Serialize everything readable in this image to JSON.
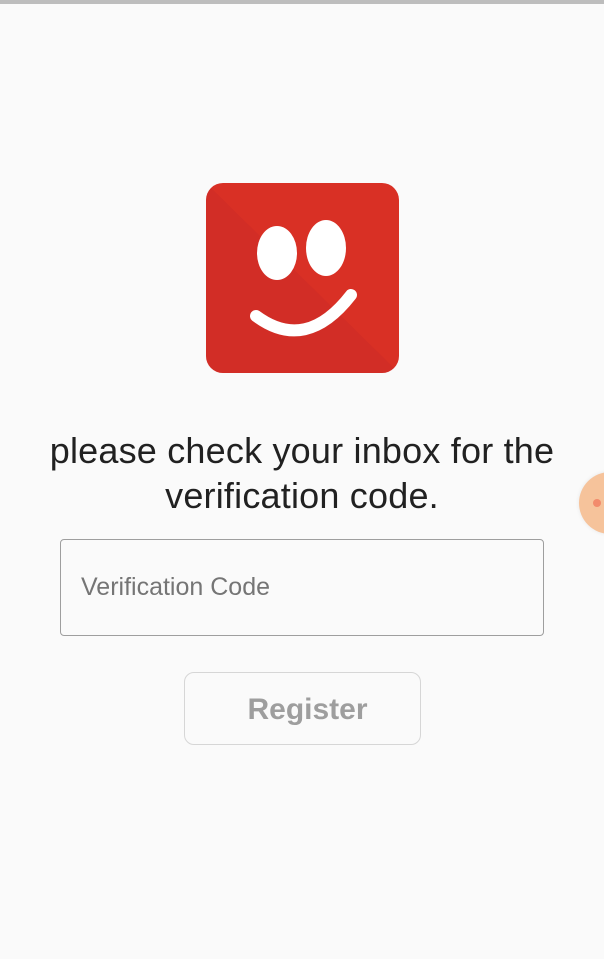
{
  "app": {
    "logo_icon": "smiley-face-icon",
    "logo_color": "#d93025",
    "logo_shadow_color": "#c62828"
  },
  "message": {
    "line1": "please check your inbox for the",
    "line2": "verification code."
  },
  "verification_field": {
    "value": "",
    "placeholder": "Verification Code"
  },
  "register_button": {
    "label": "Register",
    "enabled": false
  },
  "floating_bubble": {
    "icon": "assistant-bubble-icon",
    "color": "#f6c39b"
  }
}
